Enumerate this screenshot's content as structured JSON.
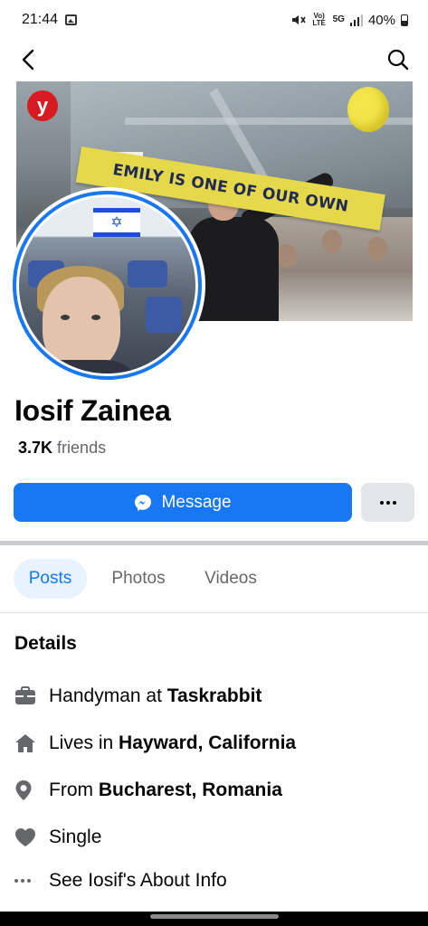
{
  "status_bar": {
    "time": "21:44",
    "volte": "Vo) LTE",
    "network": "5G",
    "battery": "40%"
  },
  "profile": {
    "name": "Iosif Zainea",
    "friends_count": "3.7K",
    "friends_label": "friends"
  },
  "cover": {
    "banner_text": "EMILY IS ONE OF OUR OWN",
    "logo_letter": "y"
  },
  "actions": {
    "message_label": "Message"
  },
  "tabs": [
    {
      "label": "Posts",
      "active": true
    },
    {
      "label": "Photos",
      "active": false
    },
    {
      "label": "Videos",
      "active": false
    }
  ],
  "details": {
    "title": "Details",
    "items": [
      {
        "icon": "briefcase-icon",
        "prefix": "Handyman at ",
        "bold": "Taskrabbit"
      },
      {
        "icon": "home-icon",
        "prefix": "Lives in ",
        "bold": "Hayward, California"
      },
      {
        "icon": "location-pin-icon",
        "prefix": "From ",
        "bold": "Bucharest, Romania"
      },
      {
        "icon": "heart-icon",
        "prefix": "Single",
        "bold": ""
      },
      {
        "icon": "more-dots-icon",
        "prefix": "See Iosif's About Info",
        "bold": ""
      }
    ]
  },
  "colors": {
    "accent": "#1877f2",
    "secondary_button": "#e4e6eb",
    "muted_text": "#65676b"
  }
}
